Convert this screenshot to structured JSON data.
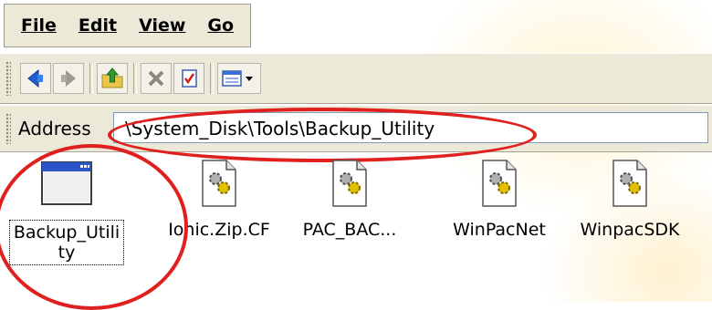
{
  "menu": {
    "items": [
      {
        "label": "File"
      },
      {
        "label": "Edit"
      },
      {
        "label": "View"
      },
      {
        "label": "Go"
      }
    ]
  },
  "toolbar": {
    "buttons": [
      "back-arrow-icon",
      "forward-arrow-icon",
      "up-folder-icon",
      "delete-icon",
      "properties-icon",
      "views-menu-icon"
    ]
  },
  "address": {
    "label": "Address",
    "value": "\\System_Disk\\Tools\\Backup_Utility"
  },
  "files": [
    {
      "name": "Backup_Utility",
      "icon": "application-window-icon",
      "selected": true
    },
    {
      "name": "Ionic.Zip.CF",
      "icon": "system-file-gear-icon",
      "selected": false
    },
    {
      "name": "PAC_BAC...",
      "icon": "system-file-gear-icon",
      "selected": false
    },
    {
      "name": "WinPacNet",
      "icon": "system-file-gear-icon",
      "selected": false
    },
    {
      "name": "WinpacSDK",
      "icon": "system-file-gear-icon",
      "selected": false
    }
  ],
  "colors": {
    "chrome": "#ece9d8",
    "annotation": "#e0201f",
    "address_border": "#7f9db9"
  }
}
